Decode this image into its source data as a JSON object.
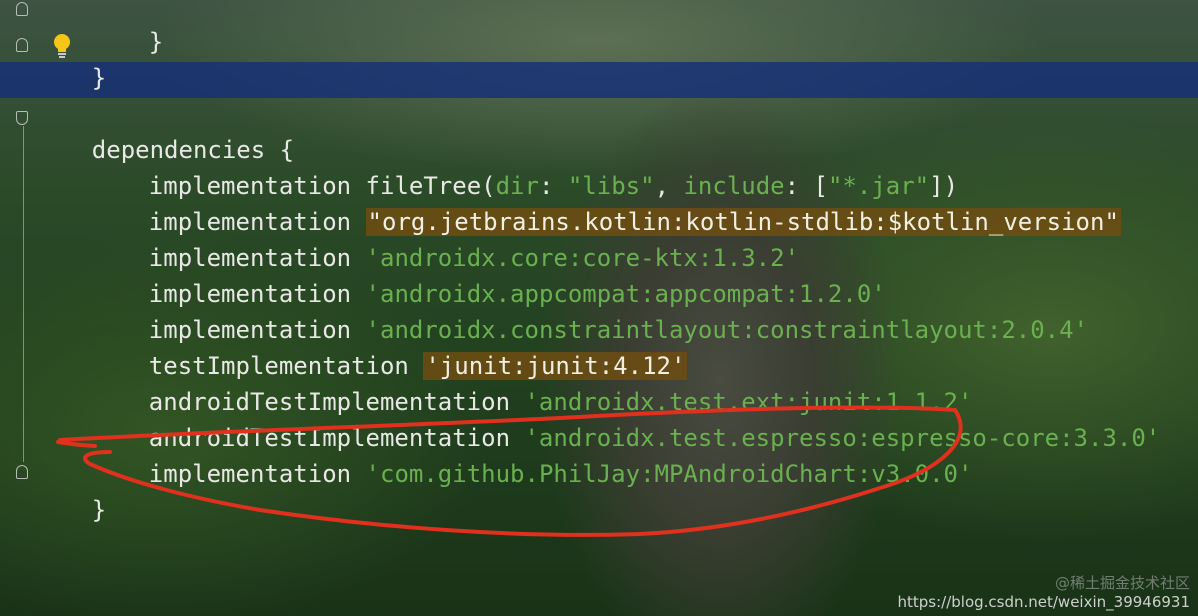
{
  "code": {
    "line_close_inner": "}",
    "line_close_outer": "}",
    "dependencies_open": "dependencies {",
    "line1": {
      "kw": "implementation ",
      "fn": "fileTree(",
      "p1": "dir",
      "sep1": ": ",
      "s1": "\"libs\"",
      "comma": ", ",
      "p2": "include",
      "sep2": ": [",
      "s2": "\"*.jar\"",
      "end": "])"
    },
    "line2": {
      "kw": "implementation ",
      "str": "\"org.jetbrains.kotlin:kotlin-stdlib:$kotlin_version\""
    },
    "line3": {
      "kw": "implementation ",
      "str": "'androidx.core:core-ktx:1.3.2'"
    },
    "line4": {
      "kw": "implementation ",
      "str": "'androidx.appcompat:appcompat:1.2.0'"
    },
    "line5": {
      "kw": "implementation ",
      "str": "'androidx.constraintlayout:constraintlayout:2.0.4'"
    },
    "line6": {
      "kw": "testImplementation ",
      "str": "'junit:junit:4.12'"
    },
    "line7": {
      "kw": "androidTestImplementation ",
      "str": "'androidx.test.ext:junit:1.1.2'"
    },
    "line8": {
      "kw": "androidTestImplementation ",
      "str": "'androidx.test.espresso:espresso-core:3.3.0'"
    },
    "line9": {
      "kw": "implementation ",
      "str": "'com.github.PhilJay:MPAndroidChart:v3.0.0'"
    },
    "dependencies_close": "}"
  },
  "colors": {
    "string": "#6bb050",
    "text": "#e8e9e5",
    "highlight_band": "#163078",
    "warning_highlight": "#6e4e12",
    "annotation_ink": "#e0301e"
  },
  "icons": {
    "intention": "lightbulb-icon",
    "fold_marker": "fold-marker-icon"
  },
  "watermark": {
    "line1": "@稀土掘金技术社区",
    "line2": "https://blog.csdn.net/weixin_39946931"
  }
}
